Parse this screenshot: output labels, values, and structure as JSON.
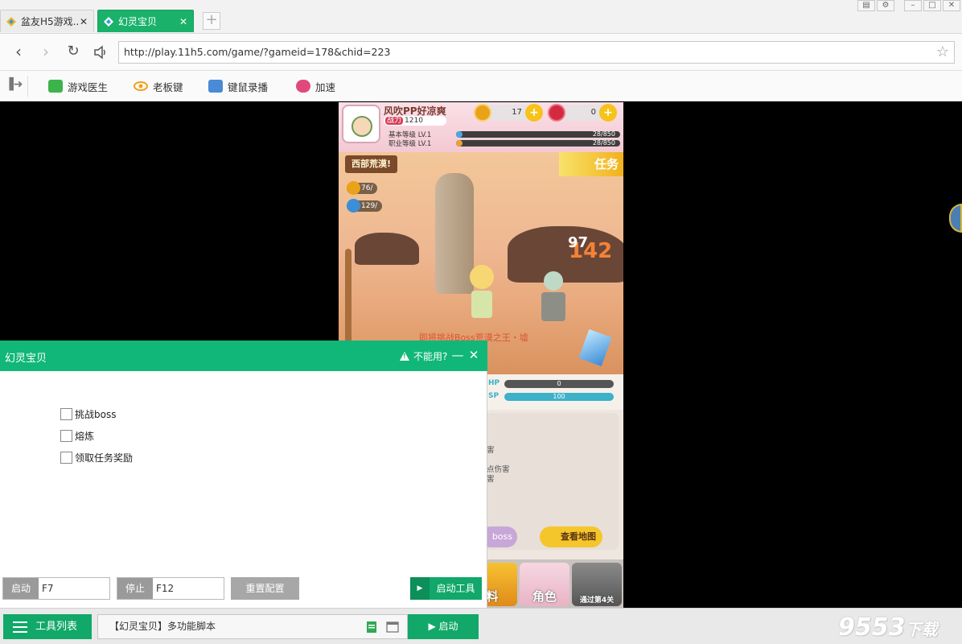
{
  "browser": {
    "tabs": [
      {
        "label": "盆友H5游戏...",
        "active": false
      },
      {
        "label": "幻灵宝贝",
        "active": true
      }
    ],
    "new_tab": "+",
    "url": "http://play.11h5.com/game/?gameid=178&chid=223",
    "toolbar": [
      {
        "label": "游戏医生",
        "icon": "game-doctor-icon",
        "color": "#3cb44b"
      },
      {
        "label": "老板键",
        "icon": "eye-icon",
        "color": "#f0a020"
      },
      {
        "label": "键鼠录播",
        "icon": "keyboard-mouse-icon",
        "color": "#4a8ad6"
      },
      {
        "label": "加速",
        "icon": "gamepad-icon",
        "color": "#e04a7a"
      }
    ]
  },
  "game": {
    "player_name": "风吹PP好凉爽",
    "power_label": "战力",
    "power_value": "1210",
    "gold": "17",
    "gems": "0",
    "base_level_label": "基本等级 LV.1",
    "job_level_label": "职业等级 LV.1",
    "base_exp": "28/850",
    "job_exp": "28/850",
    "base_exp_fraction": 0.033,
    "job_exp_fraction": 0.033,
    "zone": "西部荒漠!",
    "quest_button": "任务",
    "res_gold": "76/",
    "res_exp": "129/",
    "damage_big": "142",
    "damage_small": "97",
    "challenge_text": "即将挑战Boss荒漠之王・墟",
    "hp_label": "HP",
    "sp_label": "SP",
    "hp_value": "0",
    "sp_value": "100",
    "log_lines": [
      "害",
      "点伤害",
      "害"
    ],
    "boss_button": "boss",
    "map_button": "查看地图",
    "nav": [
      "料",
      "角色",
      "通过第4关"
    ]
  },
  "panel": {
    "title": "幻灵宝贝",
    "help": "不能用?",
    "minimize": "—",
    "close": "✕",
    "options": [
      {
        "label": "挑战boss",
        "checked": false
      },
      {
        "label": "熔炼",
        "checked": false
      },
      {
        "label": "领取任务奖励",
        "checked": false
      }
    ],
    "start_label": "启动",
    "start_key": "F7",
    "stop_label": "停止",
    "stop_key": "F12",
    "reset": "重置配置",
    "launch_tool": "启动工具"
  },
  "bottom": {
    "tool_list": "工具列表",
    "script_name": "【幻灵宝贝】多功能脚本",
    "start": "启动",
    "watermark": "9553",
    "watermark_cn": "下载"
  },
  "colors": {
    "accent": "#11b779",
    "accent_dark": "#11a86a",
    "tab_active": "#1ab26b"
  }
}
